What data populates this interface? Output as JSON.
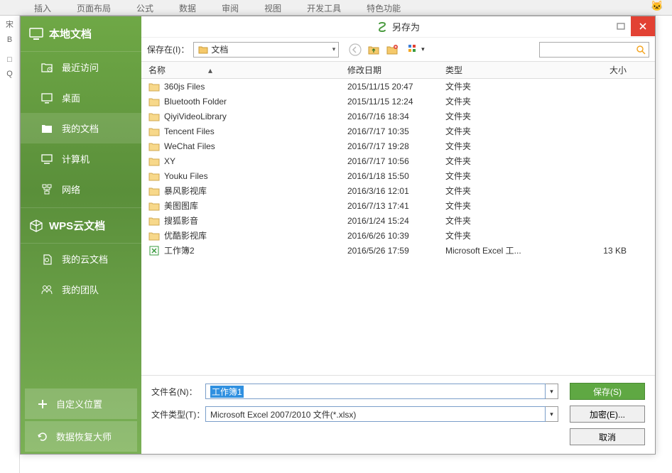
{
  "ribbon": {
    "tabs": [
      "插入",
      "页面布局",
      "公式",
      "数据",
      "审阅",
      "视图",
      "开发工具",
      "特色功能"
    ]
  },
  "left_strip": {
    "items": [
      "宋",
      "B",
      "",
      "□",
      "Q"
    ]
  },
  "decor": {
    "cat": "🐱"
  },
  "dialog": {
    "title": "另存为",
    "sidebar": {
      "header": "本地文档",
      "items": [
        {
          "label": "最近访问",
          "icon": "recent"
        },
        {
          "label": "桌面",
          "icon": "desktop"
        },
        {
          "label": "我的文档",
          "icon": "folder",
          "active": true
        },
        {
          "label": "计算机",
          "icon": "computer"
        },
        {
          "label": "网络",
          "icon": "network"
        }
      ],
      "header2": "WPS云文档",
      "items2": [
        {
          "label": "我的云文档",
          "icon": "cloud-doc"
        },
        {
          "label": "我的团队",
          "icon": "team"
        }
      ],
      "bottom": [
        {
          "label": "自定义位置",
          "icon": "plus"
        },
        {
          "label": "数据恢复大师",
          "icon": "refresh"
        }
      ]
    },
    "toolbar": {
      "save_in_label": "保存在(I)：",
      "location": "文档",
      "search_placeholder": ""
    },
    "columns": {
      "name": "名称",
      "date": "修改日期",
      "type": "类型",
      "size": "大小"
    },
    "files": [
      {
        "name": "360js Files",
        "date": "2015/11/15 20:47",
        "type": "文件夹",
        "size": "",
        "kind": "folder"
      },
      {
        "name": "Bluetooth Folder",
        "date": "2015/11/15 12:24",
        "type": "文件夹",
        "size": "",
        "kind": "folder"
      },
      {
        "name": "QiyiVideoLibrary",
        "date": "2016/7/16 18:34",
        "type": "文件夹",
        "size": "",
        "kind": "folder"
      },
      {
        "name": "Tencent Files",
        "date": "2016/7/17 10:35",
        "type": "文件夹",
        "size": "",
        "kind": "folder"
      },
      {
        "name": "WeChat Files",
        "date": "2016/7/17 19:28",
        "type": "文件夹",
        "size": "",
        "kind": "folder"
      },
      {
        "name": "XY",
        "date": "2016/7/17 10:56",
        "type": "文件夹",
        "size": "",
        "kind": "folder"
      },
      {
        "name": "Youku Files",
        "date": "2016/1/18 15:50",
        "type": "文件夹",
        "size": "",
        "kind": "folder"
      },
      {
        "name": "暴风影视库",
        "date": "2016/3/16 12:01",
        "type": "文件夹",
        "size": "",
        "kind": "folder"
      },
      {
        "name": "美图图库",
        "date": "2016/7/13 17:41",
        "type": "文件夹",
        "size": "",
        "kind": "folder"
      },
      {
        "name": "搜狐影音",
        "date": "2016/1/24 15:24",
        "type": "文件夹",
        "size": "",
        "kind": "folder"
      },
      {
        "name": "优酷影视库",
        "date": "2016/6/26 10:39",
        "type": "文件夹",
        "size": "",
        "kind": "folder"
      },
      {
        "name": "工作簿2",
        "date": "2016/5/26 17:59",
        "type": "Microsoft Excel 工...",
        "size": "13 KB",
        "kind": "xls"
      }
    ],
    "footer": {
      "filename_label": "文件名(N)：",
      "filename_value": "工作簿1",
      "filetype_label": "文件类型(T)：",
      "filetype_value": "Microsoft Excel 2007/2010 文件(*.xlsx)",
      "save_btn": "保存(S)",
      "encrypt_btn": "加密(E)...",
      "cancel_btn": "取消"
    }
  }
}
